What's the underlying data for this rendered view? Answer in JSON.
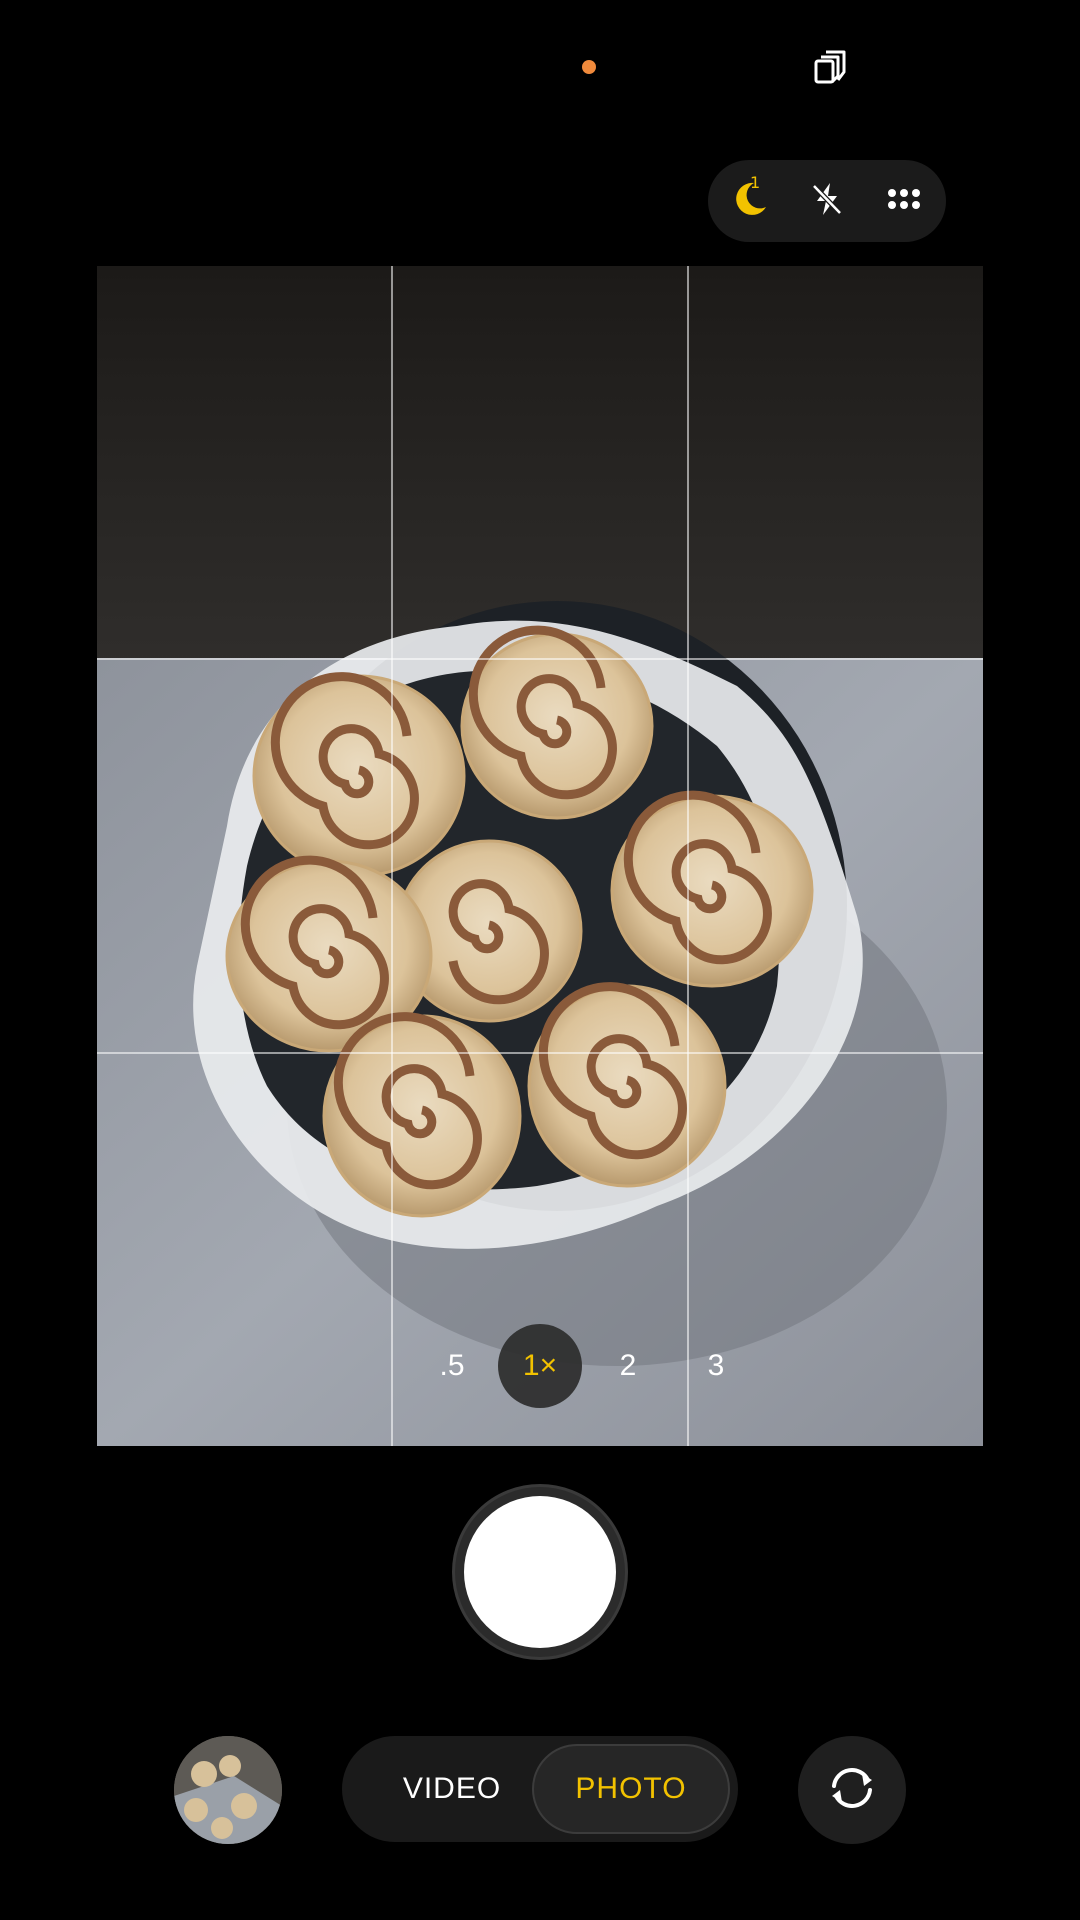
{
  "status": {
    "privacy_indicator_color": "#f08a3c",
    "top_right_icon": "layers-icon"
  },
  "quick_settings": {
    "night_mode": {
      "icon": "moon-icon",
      "badge": "1",
      "color": "#f2c200"
    },
    "flash": {
      "icon": "flash-off-icon"
    },
    "more": {
      "icon": "grid-dots-icon"
    }
  },
  "viewfinder": {
    "grid": "3x3",
    "subject": "cinnamon-rolls-in-pan"
  },
  "zoom": {
    "options": [
      ".5",
      "1×",
      "2",
      "3"
    ],
    "selected": "1×",
    "active_color": "#f2c200"
  },
  "shutter": {
    "icon": "shutter-button"
  },
  "modes": {
    "video_label": "VIDEO",
    "photo_label": "PHOTO",
    "selected": "PHOTO"
  },
  "bottom": {
    "gallery": "gallery-thumbnail",
    "switch_camera_icon": "switch-camera-icon"
  }
}
